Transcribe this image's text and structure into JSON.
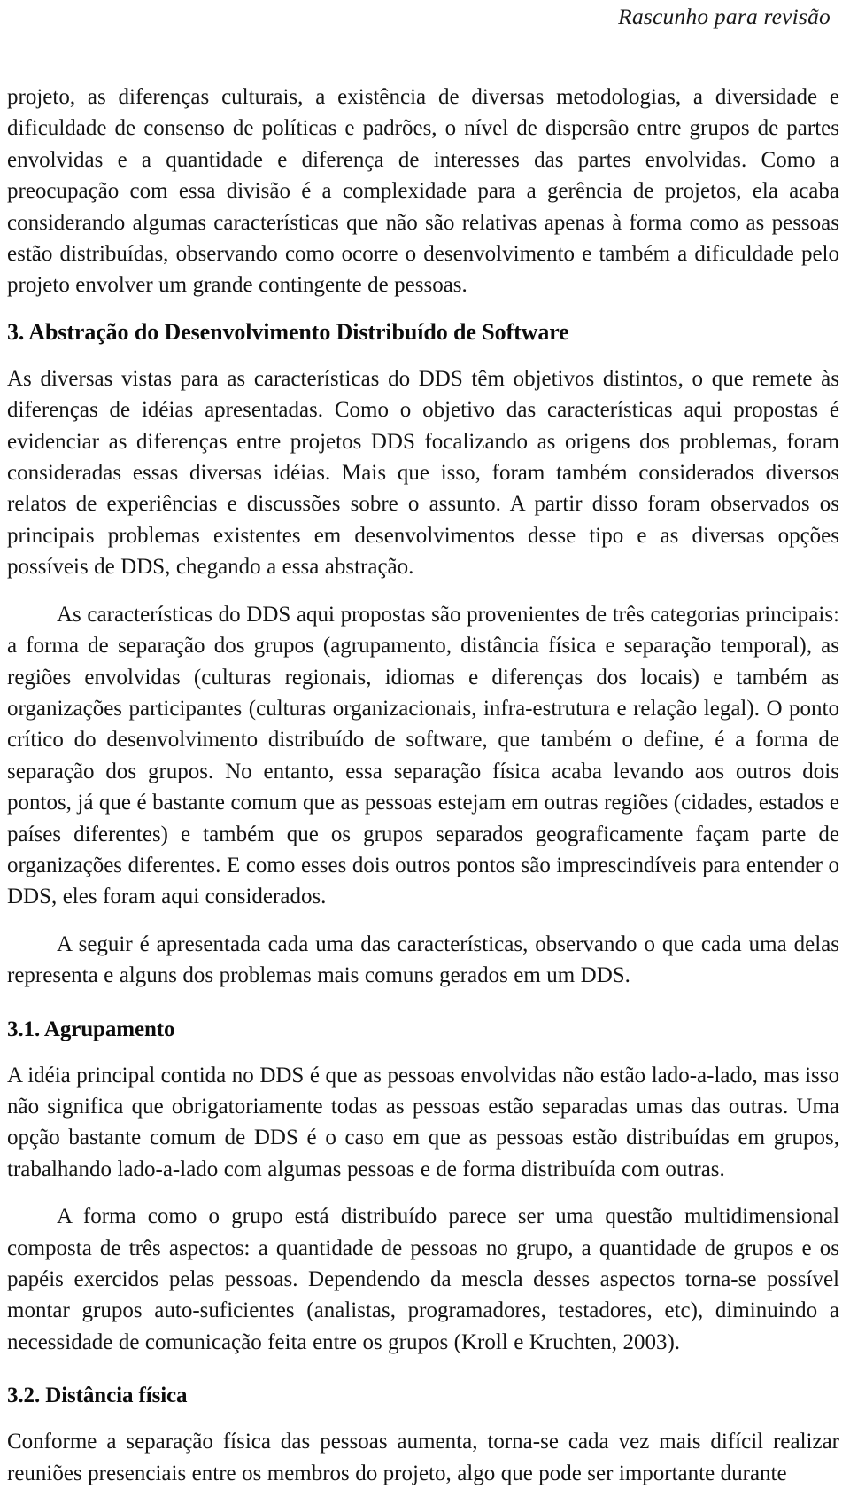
{
  "page": {
    "running_header": "Rascunho para revisão",
    "language": "pt-BR",
    "text_color": "#151515",
    "background_color": "#ffffff"
  },
  "content": {
    "paragraph_1": "projeto, as diferenças culturais, a existência de diversas metodologias, a diversidade e dificuldade de consenso de políticas e padrões, o nível de dispersão entre grupos de partes envolvidas e a quantidade e diferença de interesses das partes envolvidas. Como a preocupação com essa divisão é a complexidade para a gerência de projetos, ela acaba considerando algumas características que não são relativas apenas à forma como as pessoas estão distribuídas, observando como ocorre o desenvolvimento e também a dificuldade pelo projeto envolver um grande contingente de pessoas.",
    "heading_3": "3. Abstração do Desenvolvimento Distribuído de Software",
    "paragraph_2": "As diversas vistas para as características do DDS têm objetivos distintos, o que remete às diferenças de idéias apresentadas. Como o objetivo das características aqui propostas é evidenciar as diferenças entre projetos DDS focalizando as origens dos problemas, foram consideradas essas diversas idéias. Mais que isso, foram também considerados diversos relatos de experiências e discussões sobre o assunto. A partir disso foram observados os principais problemas existentes em desenvolvimentos desse tipo e as diversas opções possíveis de DDS, chegando a essa abstração.",
    "paragraph_3": "As características do DDS aqui propostas são provenientes de três categorias principais: a forma de separação dos grupos (agrupamento, distância física e separação temporal), as regiões envolvidas (culturas regionais, idiomas e diferenças dos locais) e também as organizações participantes (culturas organizacionais, infra-estrutura e relação legal). O ponto crítico do desenvolvimento distribuído de software, que também o define, é a forma de separação dos grupos. No entanto, essa separação física acaba levando aos outros dois pontos, já que é bastante comum que as pessoas estejam em outras regiões (cidades, estados e países diferentes) e também que os grupos separados geograficamente façam parte de organizações diferentes. E como esses dois outros pontos são imprescindíveis para entender o DDS, eles foram aqui considerados.",
    "paragraph_4": "A seguir é apresentada cada uma das características, observando o que cada uma delas representa e alguns dos problemas mais comuns gerados em um DDS.",
    "heading_3_1": "3.1. Agrupamento",
    "paragraph_5": "A idéia principal contida no DDS é que as pessoas envolvidas não estão lado-a-lado, mas isso não significa que obrigatoriamente todas as pessoas estão separadas umas das outras. Uma opção bastante comum de DDS é o caso em que as pessoas estão distribuídas em grupos, trabalhando lado-a-lado com algumas pessoas e de forma distribuída com outras.",
    "paragraph_6": "A forma como o grupo está distribuído parece ser uma questão multidimensional composta de três aspectos: a quantidade de pessoas no grupo, a quantidade de grupos e os papéis exercidos pelas pessoas. Dependendo da mescla desses aspectos torna-se possível montar grupos auto-suficientes (analistas, programadores, testadores, etc), diminuindo a necessidade de comunicação feita entre os grupos (Kroll e Kruchten, 2003).",
    "heading_3_2": "3.2. Distância física",
    "paragraph_7": "Conforme a separação física das pessoas aumenta, torna-se cada vez mais difícil realizar reuniões presenciais entre os membros do projeto, algo que pode ser importante durante"
  }
}
